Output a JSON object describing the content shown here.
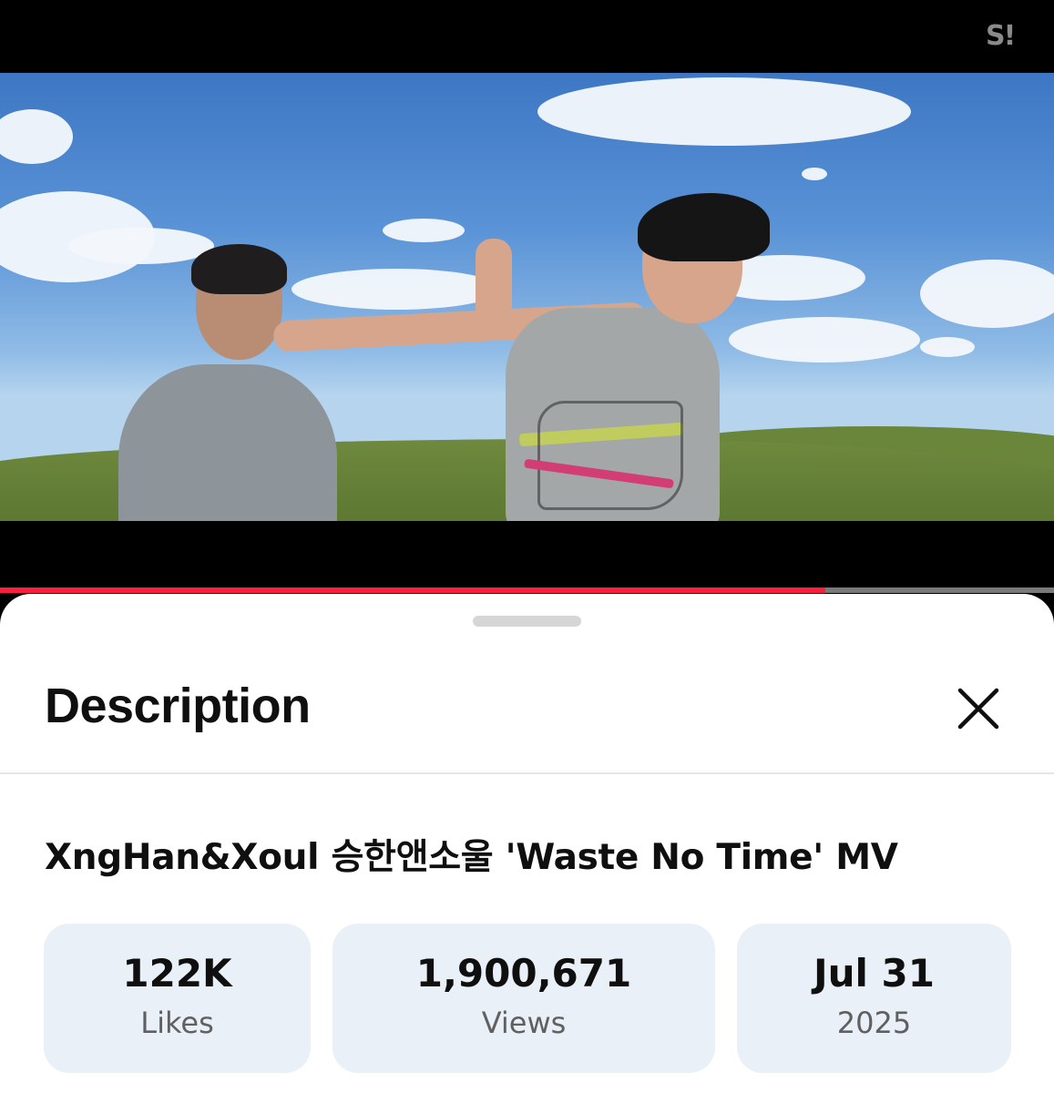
{
  "player": {
    "channel_logo_text": "S!",
    "progress_fraction": 0.783,
    "progress_color": "#ff1e3c"
  },
  "sheet": {
    "title": "Description",
    "close_icon": "close-icon",
    "video_title": "XngHan&Xoul 승한앤소울 'Waste No Time' MV",
    "stats": {
      "likes": {
        "value": "122K",
        "label": "Likes"
      },
      "views": {
        "value": "1,900,671",
        "label": "Views"
      },
      "date": {
        "value": "Jul 31",
        "label": "2025"
      }
    }
  }
}
